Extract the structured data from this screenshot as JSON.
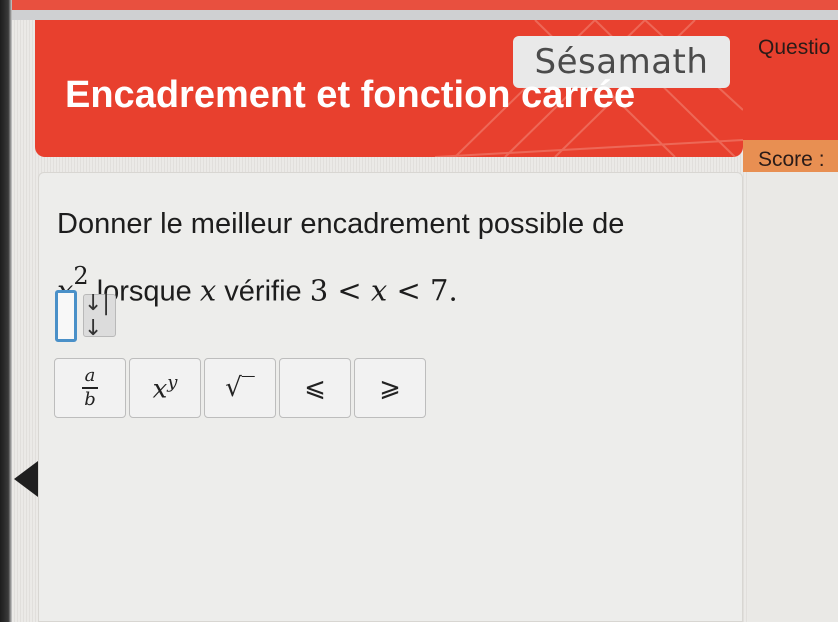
{
  "header": {
    "brand": "Sésamath",
    "title": "Encadrement et fonction carrée"
  },
  "sidebar": {
    "question_label": "Questio",
    "score_label": "Score :"
  },
  "question": {
    "line1": "Donner le meilleur encadrement possible de",
    "var": "x",
    "exponent": "2",
    "mid": " lorsque ",
    "var2": "x",
    "after": " vérifie ",
    "cond_3": "3",
    "lt1": " < ",
    "cond_x": "x",
    "lt2": " < ",
    "cond_7": "7",
    "period": "."
  },
  "answer": {
    "toggle_icon": "↓|↓"
  },
  "toolbar": {
    "frac_num": "a",
    "frac_den": "b",
    "power_base": "x",
    "power_exp": "y",
    "sqrt": "√‾",
    "leq": "⩽",
    "geq": "⩾"
  },
  "colors": {
    "header_red": "#e8402e",
    "score_orange": "#e88f52",
    "input_blue": "#4a90c8"
  },
  "icons": {
    "nav": "prev-arrow-icon"
  }
}
